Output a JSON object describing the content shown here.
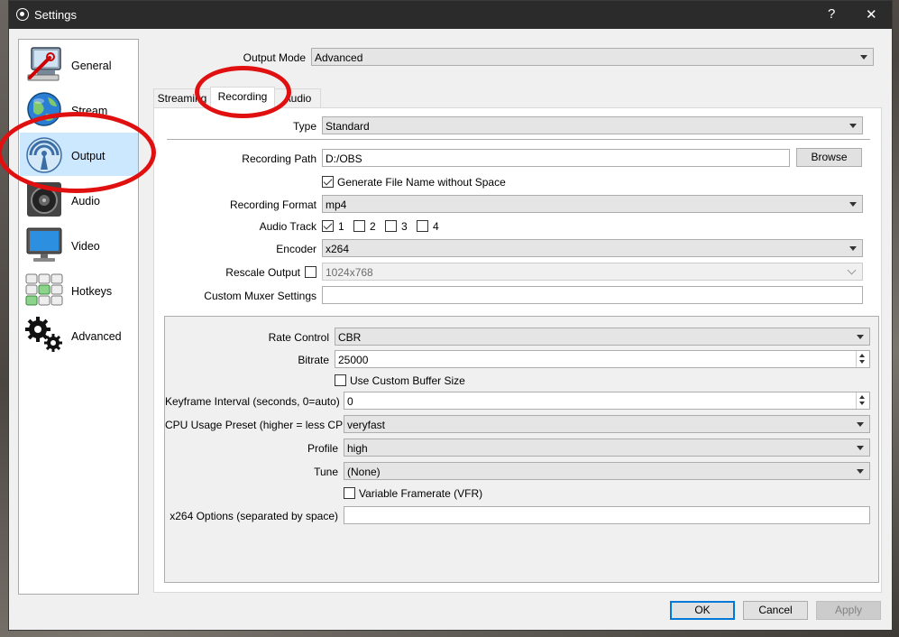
{
  "window": {
    "title": "Settings",
    "help_label": "?",
    "close_label": "✕"
  },
  "sidebar": {
    "items": [
      {
        "label": "General",
        "icon": "monitor-wrench-icon"
      },
      {
        "label": "Stream",
        "icon": "globe-icon"
      },
      {
        "label": "Output",
        "icon": "broadcast-icon",
        "selected": true
      },
      {
        "label": "Audio",
        "icon": "speaker-icon"
      },
      {
        "label": "Video",
        "icon": "monitor-icon"
      },
      {
        "label": "Hotkeys",
        "icon": "keyboard-icon"
      },
      {
        "label": "Advanced",
        "icon": "gears-icon"
      }
    ]
  },
  "output_mode": {
    "label": "Output Mode",
    "value": "Advanced"
  },
  "tabs": [
    {
      "label": "Streaming"
    },
    {
      "label": "Recording",
      "active": true
    },
    {
      "label": "Audio"
    }
  ],
  "recording": {
    "type": {
      "label": "Type",
      "value": "Standard"
    },
    "path": {
      "label": "Recording Path",
      "value": "D:/OBS",
      "browse_label": "Browse"
    },
    "gen_filename": {
      "label": "Generate File Name without Space",
      "checked": true
    },
    "format": {
      "label": "Recording Format",
      "value": "mp4"
    },
    "audio_track": {
      "label": "Audio Track",
      "tracks": [
        {
          "label": "1",
          "checked": true
        },
        {
          "label": "2",
          "checked": false
        },
        {
          "label": "3",
          "checked": false
        },
        {
          "label": "4",
          "checked": false
        }
      ]
    },
    "encoder": {
      "label": "Encoder",
      "value": "x264"
    },
    "rescale": {
      "label": "Rescale Output",
      "checked": false,
      "value": "1024x768"
    },
    "muxer": {
      "label": "Custom Muxer Settings",
      "value": ""
    }
  },
  "encoder_settings": {
    "rate_control": {
      "label": "Rate Control",
      "value": "CBR"
    },
    "bitrate": {
      "label": "Bitrate",
      "value": "25000"
    },
    "custom_buffer": {
      "label": "Use Custom Buffer Size",
      "checked": false
    },
    "keyframe": {
      "label": "Keyframe Interval (seconds, 0=auto)",
      "value": "0"
    },
    "cpu_preset": {
      "label": "CPU Usage Preset (higher = less CPU)",
      "value": "veryfast"
    },
    "profile": {
      "label": "Profile",
      "value": "high"
    },
    "tune": {
      "label": "Tune",
      "value": "(None)"
    },
    "vfr": {
      "label": "Variable Framerate (VFR)",
      "checked": false
    },
    "x264_options": {
      "label": "x264 Options (separated by space)",
      "value": ""
    }
  },
  "footer": {
    "ok_label": "OK",
    "cancel_label": "Cancel",
    "apply_label": "Apply"
  },
  "colors": {
    "highlight_ring": "#e01010",
    "selected_bg": "#cce8ff",
    "titlebar": "#2b2b2b"
  }
}
